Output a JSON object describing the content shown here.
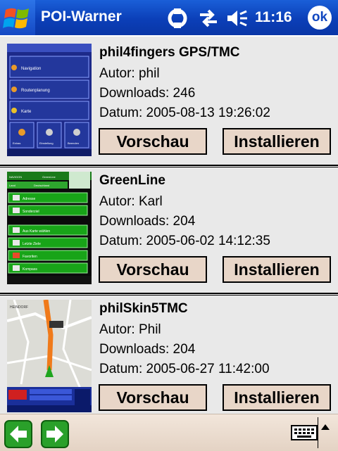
{
  "window": {
    "title": "POI-Warner",
    "clock": "11:16",
    "ok_label": "ok"
  },
  "labels": {
    "preview": "Vorschau",
    "install": "Installieren"
  },
  "items": [
    {
      "name": "phil4fingers GPS/TMC",
      "author": "Autor: phil",
      "downloads": "Downloads: 246",
      "date": "Datum: 2005-08-13 19:26:02"
    },
    {
      "name": "GreenLine",
      "author": "Autor: Karl",
      "downloads": "Downloads: 204",
      "date": "Datum: 2005-06-02 14:12:35"
    },
    {
      "name": "philSkin5TMC",
      "author": "Autor: Phil",
      "downloads": "Downloads: 204",
      "date": "Datum: 2005-06-27 11:42:00"
    }
  ],
  "thumb_text": {
    "t1": [
      "Navigation",
      "Routenplanung",
      "Karte",
      "Extras",
      "Einstellung",
      "Beenden"
    ],
    "t2": [
      "NAVIGON",
      "GreenLine",
      "Land",
      "Deutschland",
      "Adresse",
      "Sonderziel",
      "Aus Karte wählen",
      "Letzte Ziele",
      "Favoriten",
      "Kompass"
    ],
    "t3": [
      "HEINDORF"
    ]
  },
  "colors": {
    "titlebar": "#0b3fb8",
    "button_bg": "#e8d6c8",
    "accent_green": "#2fb02f"
  }
}
